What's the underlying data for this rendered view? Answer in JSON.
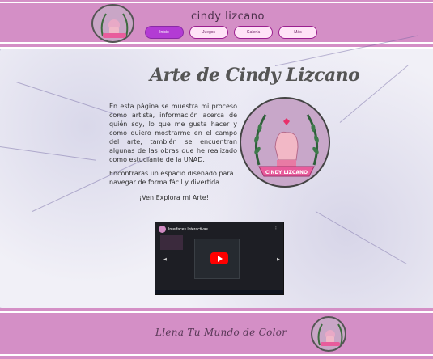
{
  "header": {
    "site_title": "cindy lizcano",
    "nav": [
      {
        "label": "Inicio",
        "active": true
      },
      {
        "label": "Juegos",
        "active": false
      },
      {
        "label": "Galería",
        "active": false
      },
      {
        "label": "Más",
        "active": false
      }
    ]
  },
  "main": {
    "title": "Arte de Cindy Lizcano",
    "paragraph1": "En esta página se muestra mi proceso como artista, información acerca de quién soy, lo que me gusta hacer y como quiero mostrarme en el campo del arte, también se encuentran algunas de las obras que he realizado como estudiante de la UNAD.",
    "paragraph2": "Encontraras un espacio diseñado para navegar de forma fácil y divertida.",
    "cta": "¡Ven Explora mi Arte!",
    "logo_banner": "CINDY LIZCANO",
    "video": {
      "title": "Interfaces Interactivas.",
      "menu_icon": "more-vert-icon",
      "play_icon": "play-icon"
    }
  },
  "footer": {
    "tagline": "Llena Tu Mundo de Color"
  },
  "colors": {
    "header_bg": "#d48fc6",
    "nav_active": "#b33bd4",
    "nav_border": "#9b1f8f",
    "marble_bg": "#f1f0f7"
  }
}
